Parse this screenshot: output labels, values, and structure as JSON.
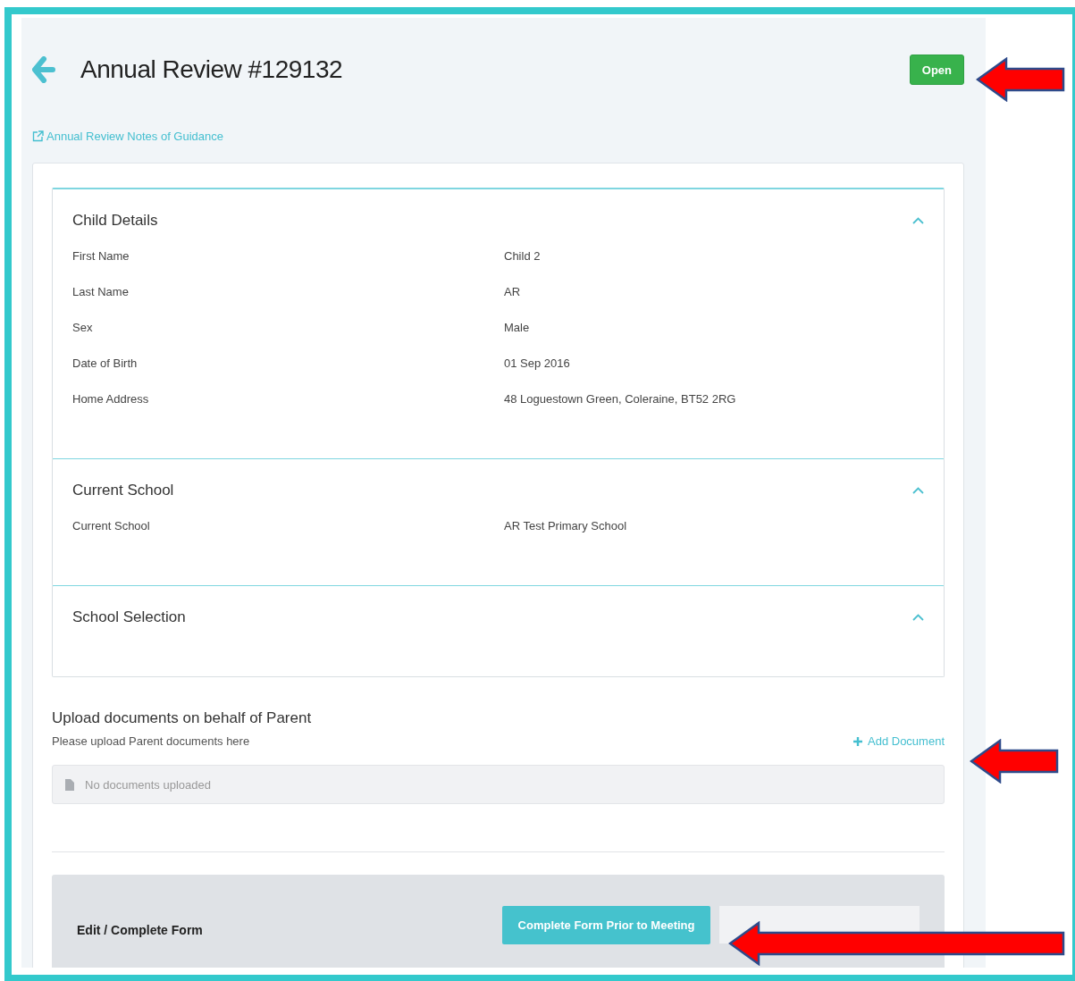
{
  "header": {
    "title": "Annual Review #129132",
    "status": "Open",
    "guidance_link": "Annual Review Notes of Guidance"
  },
  "sections": [
    {
      "title": "Child Details",
      "expanded": true,
      "fields": [
        {
          "label": "First Name",
          "value": "Child 2"
        },
        {
          "label": "Last Name",
          "value": "AR"
        },
        {
          "label": "Sex",
          "value": "Male"
        },
        {
          "label": "Date of Birth",
          "value": "01 Sep 2016"
        },
        {
          "label": "Home Address",
          "value": "48 Loguestown Green, Coleraine, BT52 2RG"
        }
      ]
    },
    {
      "title": "Current School",
      "expanded": true,
      "fields": [
        {
          "label": "Current School",
          "value": "AR Test Primary School"
        }
      ]
    },
    {
      "title": "School Selection",
      "expanded": true
    }
  ],
  "upload": {
    "title": "Upload documents on behalf of Parent",
    "subtitle": "Please upload Parent documents here",
    "add_button": "Add Document",
    "empty_text": "No documents uploaded"
  },
  "form_panel": {
    "label": "Edit / Complete Form",
    "button": "Complete Form Prior to Meeting"
  }
}
